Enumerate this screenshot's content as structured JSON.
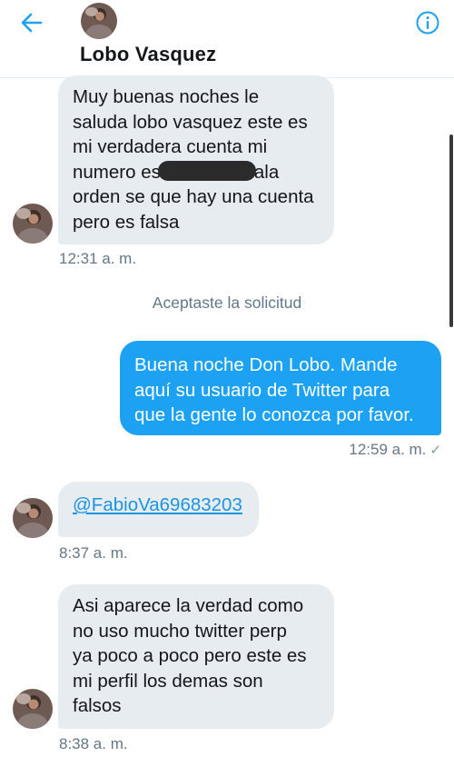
{
  "header": {
    "contact_name": "Lobo Vasquez",
    "back_icon": "arrow-left-icon",
    "info_icon": "info-circle-icon",
    "accent": "#1da1f2"
  },
  "messages": [
    {
      "direction": "incoming",
      "lines": [
        "Muy buenas noches le",
        "saluda lobo vasquez este es",
        "mi verdadera cuenta mi",
        "numero es",
        "ala",
        "orden se que hay una cuenta",
        "pero es falsa"
      ],
      "time": "12:31 a. m."
    },
    {
      "direction": "system",
      "text": "Aceptaste la solicitud"
    },
    {
      "direction": "outgoing",
      "lines": [
        "Buena noche Don Lobo. Mande",
        "aquí su usuario de Twitter para",
        "que la gente lo conozca por favor."
      ],
      "time": "12:59 a. m.",
      "status": "✓"
    },
    {
      "direction": "incoming",
      "link": "@FabioVa69683203",
      "time": "8:37 a. m."
    },
    {
      "direction": "incoming",
      "lines": [
        "Asi aparece la verdad como",
        "no uso mucho twitter perp",
        "ya poco a poco pero este es",
        "mi perfil los demas son",
        "falsos"
      ],
      "time": "8:38 a. m."
    }
  ],
  "colors": {
    "incoming_bubble": "#e6ecf0",
    "outgoing_bubble": "#1da1f2",
    "meta_text": "#657786"
  }
}
